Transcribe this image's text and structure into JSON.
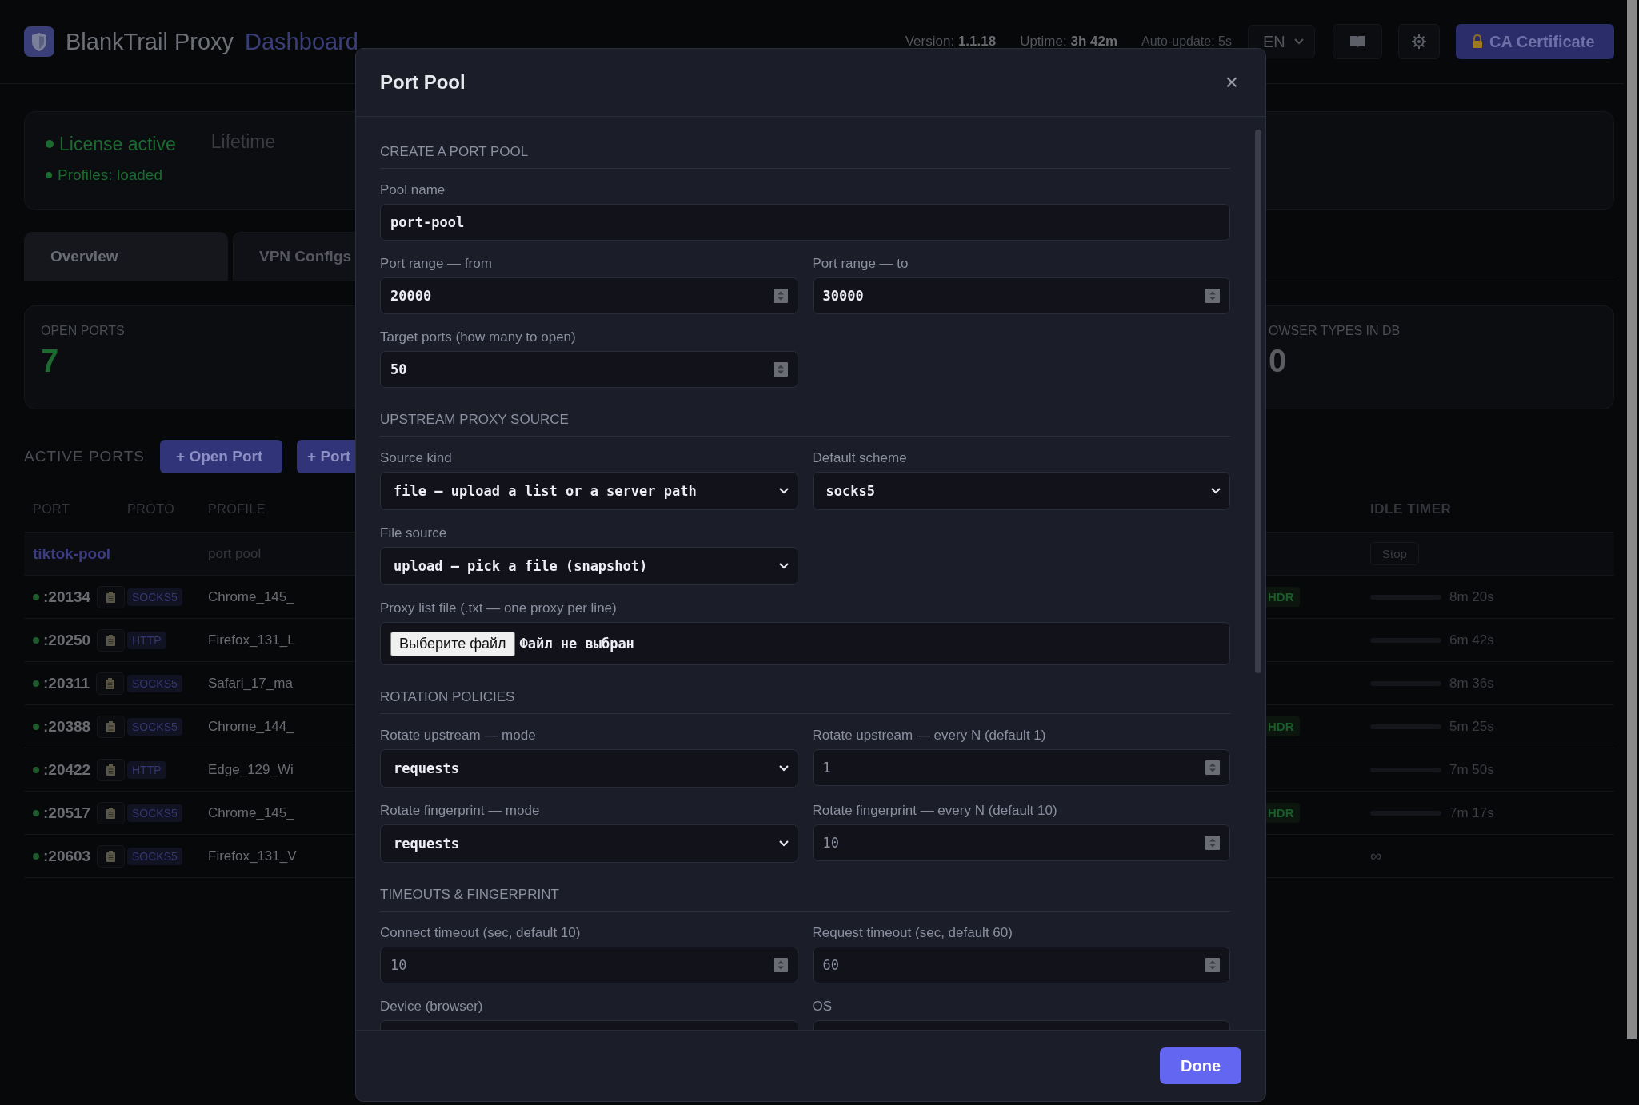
{
  "header": {
    "brand": "BlankTrail Proxy",
    "brand_sub": "Dashboard",
    "version_label": "Version:",
    "version": "1.1.18",
    "uptime_label": "Uptime:",
    "uptime": "3h 42m",
    "autoupdate": "Auto-update: 5s",
    "language": "EN",
    "ca_button": "CA Certificate"
  },
  "license": {
    "status": "License active",
    "plan": "Lifetime",
    "profiles": "Profiles: loaded"
  },
  "tabs": [
    {
      "label": "Overview",
      "selected": true
    },
    {
      "label": "VPN Configs",
      "selected": false
    }
  ],
  "stats": [
    {
      "label": "OPEN PORTS",
      "value": "7"
    },
    {
      "label": "OWSER TYPES IN DB",
      "value": "0"
    }
  ],
  "active_ports": {
    "title": "ACTIVE PORTS",
    "buttons": [
      "+ Open Port",
      "+ Port"
    ]
  },
  "table": {
    "columns": [
      "PORT",
      "PROTO",
      "PROFILE"
    ],
    "column_right": "IDLE TIMER",
    "pool_row": {
      "name": "tiktok-pool",
      "profile": "port pool",
      "action": "Stop"
    },
    "rows": [
      {
        "port": ":20134",
        "proto": "SOCKS5",
        "profile": "Chrome_145_",
        "tag": "HDR",
        "timer": "8m 20s"
      },
      {
        "port": ":20250",
        "proto": "HTTP",
        "profile": "Firefox_131_L",
        "timer": "6m 42s"
      },
      {
        "port": ":20311",
        "proto": "SOCKS5",
        "profile": "Safari_17_ma",
        "timer": "8m 36s"
      },
      {
        "port": ":20388",
        "proto": "SOCKS5",
        "profile": "Chrome_144_",
        "tag": "HDR",
        "timer": "5m 25s"
      },
      {
        "port": ":20422",
        "proto": "HTTP",
        "profile": "Edge_129_Wi",
        "timer": "7m 50s"
      },
      {
        "port": ":20517",
        "proto": "SOCKS5",
        "profile": "Chrome_145_",
        "tag": "HDR",
        "timer": "7m 17s"
      },
      {
        "port": ":20603",
        "proto": "SOCKS5",
        "profile": "Firefox_131_V",
        "timer": "∞"
      }
    ]
  },
  "modal": {
    "title": "Port Pool",
    "close": "×",
    "sections": [
      {
        "title": "CREATE A PORT POOL",
        "fields": [
          {
            "kind": "text",
            "label": "Pool name",
            "value": "port-pool",
            "wide": true
          },
          {
            "kind": "number",
            "label": "Port range — from",
            "value": "20000"
          },
          {
            "kind": "number",
            "label": "Port range — to",
            "value": "30000"
          },
          {
            "kind": "number",
            "label": "Target ports (how many to open)",
            "value": "50"
          }
        ]
      },
      {
        "title": "UPSTREAM PROXY SOURCE",
        "fields": [
          {
            "kind": "select",
            "label": "Source kind",
            "value": "file — upload a list or a server path"
          },
          {
            "kind": "select",
            "label": "Default scheme",
            "value": "socks5"
          },
          {
            "kind": "select",
            "label": "File source",
            "value": "upload — pick a file (snapshot)"
          },
          {
            "kind": "file",
            "label": "Proxy list file (.txt — one proxy per line)",
            "button": "Выберите файл",
            "value": "Файл не выбран",
            "wide": true
          }
        ]
      },
      {
        "title": "ROTATION POLICIES",
        "fields": [
          {
            "kind": "select",
            "label": "Rotate upstream — mode",
            "value": "requests"
          },
          {
            "kind": "number",
            "label": "Rotate upstream — every N (default 1)",
            "placeholder": "1"
          },
          {
            "kind": "select",
            "label": "Rotate fingerprint — mode",
            "value": "requests"
          },
          {
            "kind": "number",
            "label": "Rotate fingerprint — every N (default 10)",
            "placeholder": "10"
          }
        ]
      },
      {
        "title": "TIMEOUTS & FINGERPRINT",
        "fields": [
          {
            "kind": "number",
            "label": "Connect timeout (sec, default 10)",
            "placeholder": "10"
          },
          {
            "kind": "number",
            "label": "Request timeout (sec, default 60)",
            "placeholder": "60"
          },
          {
            "kind": "select",
            "label": "Device (browser)"
          },
          {
            "kind": "select",
            "label": "OS"
          }
        ]
      }
    ],
    "done": "Done"
  }
}
